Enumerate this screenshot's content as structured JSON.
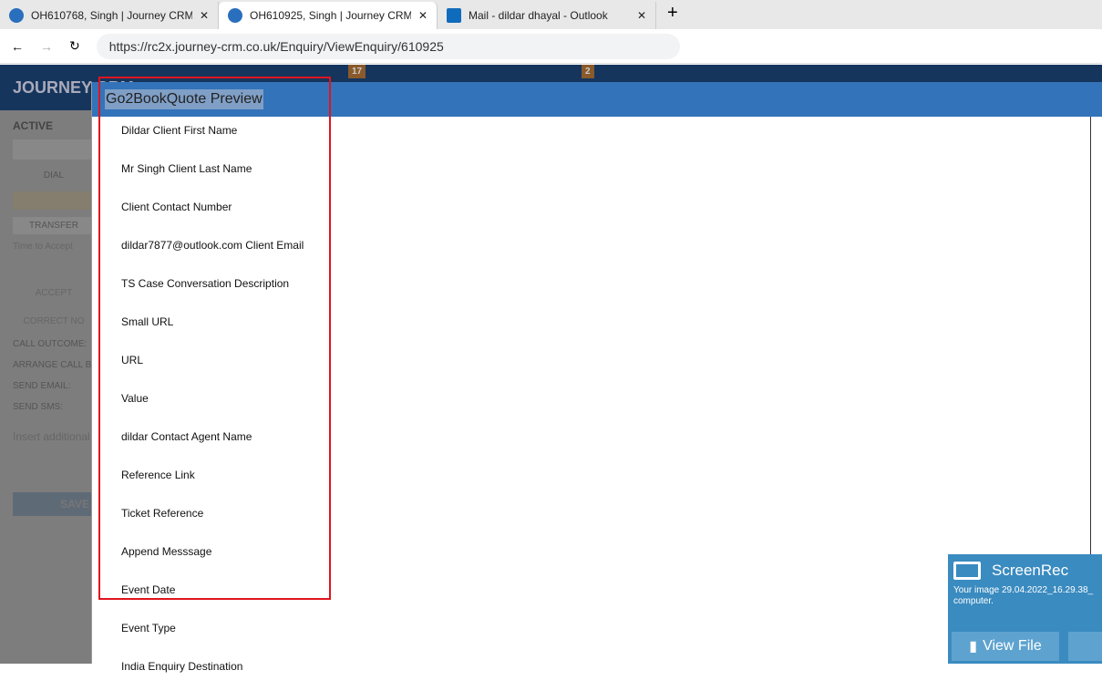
{
  "browser": {
    "tabs": [
      {
        "title": "OH610768, Singh | Journey CRM"
      },
      {
        "title": "OH610925, Singh | Journey CRM",
        "active": true
      },
      {
        "title": "Mail - dildar dhayal - Outlook"
      }
    ],
    "url": "https://rc2x.journey-crm.co.uk/Enquiry/ViewEnquiry/610925"
  },
  "app": {
    "brand": "JOURNEY CRM",
    "badges": [
      "17",
      "2"
    ],
    "left": {
      "status": "ACTIVE",
      "dial": "DIAL",
      "transfer": "TRANSFER",
      "time_to_accept": "Time to Accept",
      "accept": "ACCEPT",
      "correct_no": "CORRECT NO",
      "call_outcome": "CALL OUTCOME:",
      "arrange_call": "ARRANGE CALL B",
      "send_email": "SEND EMAIL:",
      "send_sms": "SEND SMS:",
      "notes_placeholder": "Insert additional",
      "save": "SAVE"
    }
  },
  "modal": {
    "title": "Go2BookQuote Preview",
    "fields": [
      "Dildar Client First Name",
      "Mr Singh Client Last Name",
      "Client Contact Number",
      "dildar7877@outlook.com Client Email",
      "TS Case Conversation Description",
      "Small URL",
      "URL",
      "Value",
      "dildar Contact Agent Name",
      "Reference Link",
      "Ticket Reference",
      "Append Messsage",
      "Event Date",
      "Event Type",
      "India Enquiry Destination"
    ]
  },
  "screenrec": {
    "title": "ScreenRec",
    "message": "Your image 29.04.2022_16.29.38_",
    "message2": "computer.",
    "view_file": "View File"
  }
}
